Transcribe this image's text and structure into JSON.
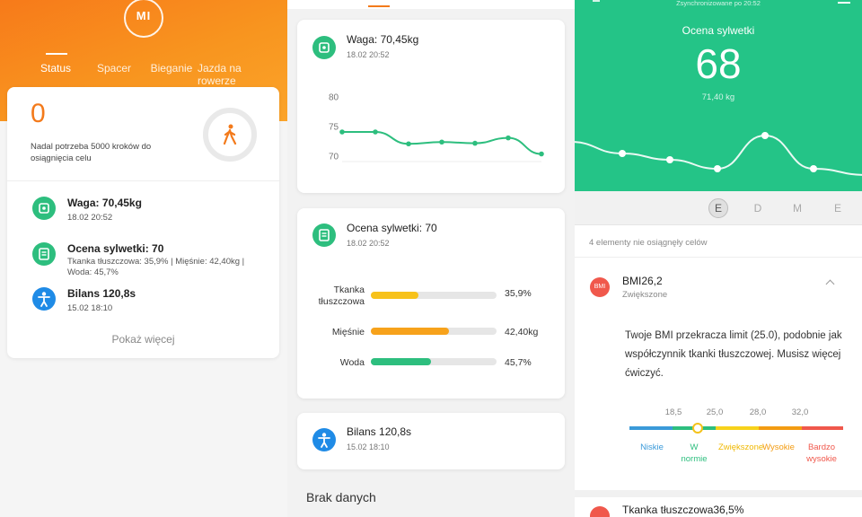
{
  "panel1": {
    "logo": "MI",
    "tabs": [
      {
        "label": "Status",
        "active": true
      },
      {
        "label": "Spacer",
        "active": false
      },
      {
        "label": "Bieganie",
        "active": false
      },
      {
        "label": "Jazda na rowerze",
        "active": false
      }
    ],
    "steps": {
      "value": "0",
      "message": "Nadal potrzeba 5000 kroków do osiągnięcia celu"
    },
    "items": [
      {
        "title": "Waga: 70,45kg",
        "sub": "18.02 20:52",
        "icon": "scale-icon",
        "color": "#2dbe7e"
      },
      {
        "title": "Ocena sylwetki: 70",
        "sub": "Tkanka tłuszczowa: 35,9% | Mięśnie: 42,40kg | Woda: 45,7%",
        "icon": "body-score-icon",
        "color": "#2dbe7e"
      },
      {
        "title": "Bilans 120,8s",
        "sub": "15.02 18:10",
        "icon": "person-icon",
        "color": "#1f8be6"
      }
    ],
    "more": "Pokaż więcej"
  },
  "panel2": {
    "weight_card": {
      "title": "Waga: 70,45kg",
      "date": "18.02 20:52"
    },
    "score_card": {
      "title": "Ocena sylwetki: 70",
      "date": "18.02 20:52",
      "bars": [
        {
          "label": "Tkanka tłuszczowa",
          "value": "35,9%",
          "fraction": 0.38,
          "color": "#f7c21b"
        },
        {
          "label": "Mięśnie",
          "value": "42,40kg",
          "fraction": 0.62,
          "color": "#f7a21b"
        },
        {
          "label": "Woda",
          "value": "45,7%",
          "fraction": 0.48,
          "color": "#2dbe7e"
        }
      ]
    },
    "balance_card": {
      "title": "Bilans 120,8s",
      "date": "15.02 18:10"
    },
    "no_data": "Brak danych"
  },
  "chart_data": [
    {
      "type": "line",
      "title": "",
      "ylim": [
        66,
        82
      ],
      "yticks": [
        80,
        75,
        70
      ],
      "values": [
        74,
        74,
        72,
        72.3,
        72.1,
        73,
        70.3
      ],
      "color": "#2dbe7e"
    },
    {
      "type": "line",
      "title": "",
      "values": [
        0.55,
        0.42,
        0.35,
        0.25,
        0.62,
        0.25,
        0.18
      ],
      "color": "#ffffff"
    }
  ],
  "panel3": {
    "sync": "Zsynchronizowane po 20:52",
    "score_label": "Ocena sylwetki",
    "score": "68",
    "score_sub": "71,40 kg",
    "ranges": [
      {
        "label": "E",
        "active": true
      },
      {
        "label": "D",
        "active": false
      },
      {
        "label": "M",
        "active": false
      },
      {
        "label": "E",
        "active": false
      }
    ],
    "goals": "4 elementy nie osiągnęły celów",
    "bmi": {
      "badge": "BMI",
      "title": "BMI26,2",
      "status": "Zwiększone",
      "description": "Twoje BMI przekracza limit (25.0), podobnie jak współczynnik tkanki tłuszczowej. Musisz więcej ćwiczyć.",
      "scale_values": [
        "18,5",
        "25,0",
        "28,0",
        "32,0"
      ],
      "scale_labels": [
        {
          "label": "Niskie",
          "color": "#3a9ad9"
        },
        {
          "label": "W normie",
          "color": "#2dbe7e"
        },
        {
          "label": "Zwiększone",
          "color": "#f0b800"
        },
        {
          "label": "Wysokie",
          "color": "#f39c12"
        },
        {
          "label": "Bardzo wysokie",
          "color": "#f0584c"
        }
      ],
      "position": 0.32
    },
    "next_item": "Tkanka tłuszczowa36,5%"
  }
}
